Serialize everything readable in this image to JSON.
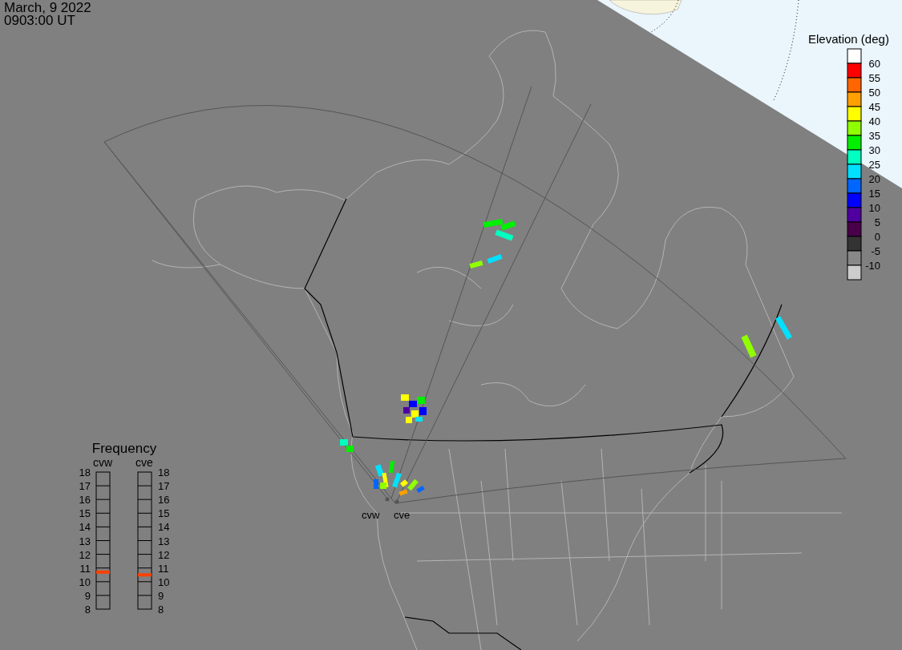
{
  "header": {
    "date": "March, 9 2022",
    "time": "0903:00 UT"
  },
  "map": {
    "radar_labels": [
      "cvw",
      "cve"
    ]
  },
  "elevation_legend": {
    "title": "Elevation (deg)",
    "bins": [
      {
        "color": "#ffffff"
      },
      {
        "color": "#ff0000"
      },
      {
        "color": "#ff6600"
      },
      {
        "color": "#ffa000"
      },
      {
        "color": "#ffff00"
      },
      {
        "color": "#90ff00"
      },
      {
        "color": "#00f000"
      },
      {
        "color": "#00ffc0"
      },
      {
        "color": "#00e0ff"
      },
      {
        "color": "#0066ff"
      },
      {
        "color": "#0000ff"
      },
      {
        "color": "#5000a0"
      },
      {
        "color": "#480048"
      },
      {
        "color": "#333333"
      },
      {
        "color": "#888888"
      },
      {
        "color": "#cccccc"
      }
    ],
    "ticks": [
      "60",
      "55",
      "50",
      "45",
      "40",
      "35",
      "30",
      "25",
      "20",
      "15",
      "10",
      "5",
      "0",
      "-5",
      "-10"
    ]
  },
  "frequency": {
    "title": "Frequency",
    "left_ticks": [
      "18",
      "17",
      "16",
      "15",
      "14",
      "13",
      "12",
      "11",
      "10",
      "9",
      "8"
    ],
    "right_ticks": [
      "18",
      "17",
      "16",
      "15",
      "14",
      "13",
      "12",
      "11",
      "10",
      "9",
      "8"
    ],
    "radars": [
      {
        "name": "cvw",
        "level": 0.27
      },
      {
        "name": "cve",
        "level": 0.25
      }
    ]
  }
}
